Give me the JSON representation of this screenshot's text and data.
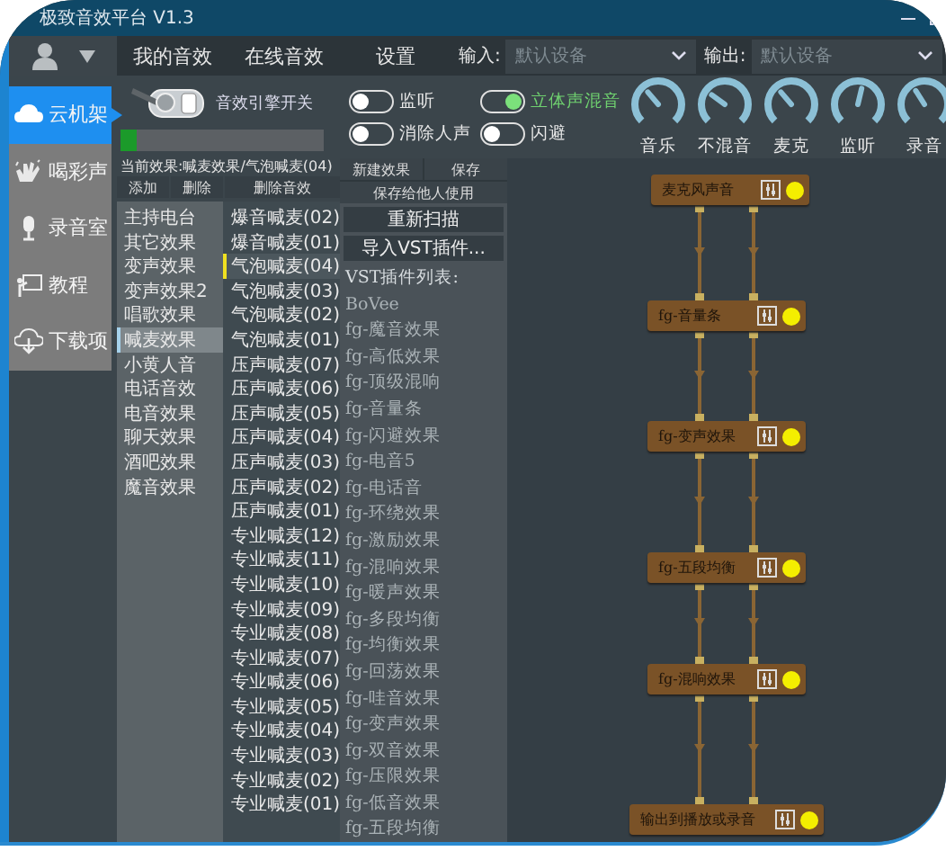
{
  "window": {
    "title": "极致音效平台 V1.3"
  },
  "nav_tabs": [
    {
      "label": "我的音效"
    },
    {
      "label": "在线音效"
    },
    {
      "label": "设置"
    }
  ],
  "input": {
    "label": "输入:",
    "value": "默认设备"
  },
  "output": {
    "label": "输出:",
    "value": "默认设备"
  },
  "sidebar": {
    "items": [
      {
        "label": "云机架",
        "selected": true
      },
      {
        "label": "喝彩声",
        "selected": false
      },
      {
        "label": "录音室",
        "selected": false
      },
      {
        "label": "教程",
        "selected": false
      },
      {
        "label": "下载项",
        "selected": false
      }
    ]
  },
  "engine": {
    "label": "音效引擎开关",
    "on": true
  },
  "progress": {
    "level": 0.08
  },
  "current_effect": "当前效果:喊麦效果/气泡喊麦(04)",
  "effect_buttons": [
    "添加",
    "删除",
    "删除音效"
  ],
  "categories": [
    {
      "label": "主持电台",
      "selected": false
    },
    {
      "label": "其它效果",
      "selected": false
    },
    {
      "label": "变声效果",
      "selected": false
    },
    {
      "label": "变声效果2",
      "selected": false
    },
    {
      "label": "唱歌效果",
      "selected": false
    },
    {
      "label": "喊麦效果",
      "selected": true
    },
    {
      "label": "小黄人音",
      "selected": false
    },
    {
      "label": "电话音效",
      "selected": false
    },
    {
      "label": "电音效果",
      "selected": false
    },
    {
      "label": "聊天效果",
      "selected": false
    },
    {
      "label": "酒吧效果",
      "selected": false
    },
    {
      "label": "魔音效果",
      "selected": false
    }
  ],
  "presets": [
    {
      "label": "爆音喊麦(02)",
      "selected": false
    },
    {
      "label": "爆音喊麦(01)",
      "selected": false
    },
    {
      "label": "气泡喊麦(04)",
      "selected": true
    },
    {
      "label": "气泡喊麦(03)",
      "selected": false
    },
    {
      "label": "气泡喊麦(02)",
      "selected": false
    },
    {
      "label": "气泡喊麦(01)",
      "selected": false
    },
    {
      "label": "压声喊麦(07)",
      "selected": false
    },
    {
      "label": "压声喊麦(06)",
      "selected": false
    },
    {
      "label": "压声喊麦(05)",
      "selected": false
    },
    {
      "label": "压声喊麦(04)",
      "selected": false
    },
    {
      "label": "压声喊麦(03)",
      "selected": false
    },
    {
      "label": "压声喊麦(02)",
      "selected": false
    },
    {
      "label": "压声喊麦(01)",
      "selected": false
    },
    {
      "label": "专业喊麦(12)",
      "selected": false
    },
    {
      "label": "专业喊麦(11)",
      "selected": false
    },
    {
      "label": "专业喊麦(10)",
      "selected": false
    },
    {
      "label": "专业喊麦(09)",
      "selected": false
    },
    {
      "label": "专业喊麦(08)",
      "selected": false
    },
    {
      "label": "专业喊麦(07)",
      "selected": false
    },
    {
      "label": "专业喊麦(06)",
      "selected": false
    },
    {
      "label": "专业喊麦(05)",
      "selected": false
    },
    {
      "label": "专业喊麦(04)",
      "selected": false
    },
    {
      "label": "专业喊麦(03)",
      "selected": false
    },
    {
      "label": "专业喊麦(02)",
      "selected": false
    },
    {
      "label": "专业喊麦(01)",
      "selected": false
    }
  ],
  "plugin_buttons": [
    "新建效果",
    "保存",
    "保存给他人使用"
  ],
  "actions": [
    "重新扫描",
    "导入VST插件..."
  ],
  "vst_list": {
    "title": "VST插件列表:",
    "items": [
      "BoVee",
      "fg-魔音效果",
      "fg-高低效果",
      "fg-顶级混响",
      "fg-音量条",
      "fg-闪避效果",
      "fg-电音5",
      "fg-电话音",
      "fg-环绕效果",
      "fg-激励效果",
      "fg-混响效果",
      "fg-暖声效果",
      "fg-多段均衡",
      "fg-均衡效果",
      "fg-回荡效果",
      "fg-哇音效果",
      "fg-变声效果",
      "fg-双音效果",
      "fg-压限效果",
      "fg-低音效果",
      "fg-五段均衡"
    ]
  },
  "toggles": [
    {
      "label": "监听",
      "on": false
    },
    {
      "label": "立体声混音",
      "on": true
    },
    {
      "label": "消除人声",
      "on": false
    },
    {
      "label": "闪避",
      "on": false
    }
  ],
  "knobs": [
    {
      "label": "音乐",
      "level": 0.35
    },
    {
      "label": "不混音",
      "level": 0.3
    },
    {
      "label": "麦克",
      "level": 0.35
    },
    {
      "label": "监听",
      "level": 0.55
    },
    {
      "label": "录音",
      "level": 0.38
    }
  ],
  "chain": {
    "nodes": [
      "麦克风声音",
      "fg-音量条",
      "fg-变声效果",
      "fg-五段均衡",
      "fg-混响效果",
      "输出到播放或录音"
    ]
  }
}
